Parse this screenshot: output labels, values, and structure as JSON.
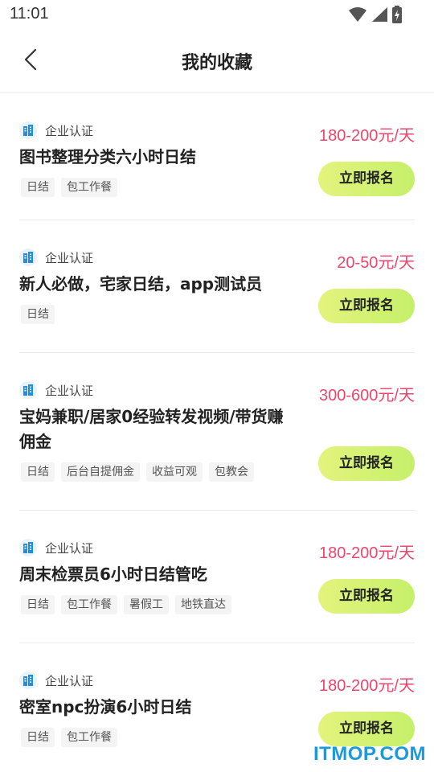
{
  "status_bar": {
    "time": "11:01",
    "icons": [
      "wifi-icon",
      "signal-icon",
      "battery-charging-icon"
    ]
  },
  "nav": {
    "title": "我的收藏",
    "back_icon": "chevron-left-icon"
  },
  "cards": [
    {
      "cert_label": "企业认证",
      "cert_icon": "building-icon",
      "title": "图书整理分类六小时日结",
      "price": "180-200元/天",
      "tags": [
        "日结",
        "包工作餐"
      ],
      "button": "立即报名"
    },
    {
      "cert_label": "企业认证",
      "cert_icon": "building-icon",
      "title": "新人必做，宅家日结，app测试员",
      "price": "20-50元/天",
      "tags": [
        "日结"
      ],
      "button": "立即报名"
    },
    {
      "cert_label": "企业认证",
      "cert_icon": "building-icon",
      "title": "宝妈兼职/居家0经验转发视频/带货赚佣金",
      "price": "300-600元/天",
      "tags": [
        "日结",
        "后台自提佣金",
        "收益可观",
        "包教会"
      ],
      "button": "立即报名"
    },
    {
      "cert_label": "企业认证",
      "cert_icon": "building-icon",
      "title": "周末检票员6小时日结管吃",
      "price": "180-200元/天",
      "tags": [
        "日结",
        "包工作餐",
        "暑假工",
        "地铁直达"
      ],
      "button": "立即报名"
    },
    {
      "cert_label": "企业认证",
      "cert_icon": "building-icon",
      "title": "密室npc扮演6小时日结",
      "price": "180-200元/天",
      "tags": [
        "日结",
        "包工作餐"
      ],
      "button": "立即报名"
    }
  ],
  "watermark": "ITMOP.COM",
  "colors": {
    "price": "#f0456a",
    "button_start": "#e4f37d",
    "button_end": "#c5f06a",
    "cert_icon": "#1e8fe0",
    "watermark": "#1a9ad8"
  }
}
